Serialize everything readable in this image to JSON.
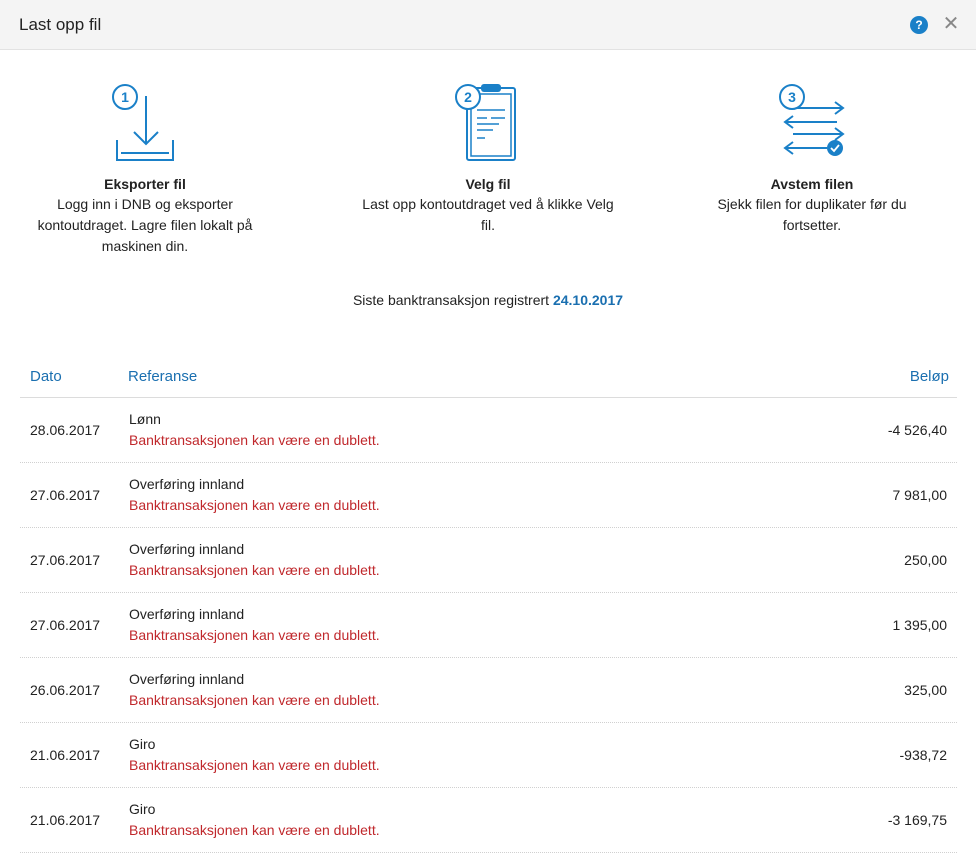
{
  "dialog": {
    "title": "Last opp fil",
    "help_icon": "question-circle-icon",
    "help_label": "?",
    "close_icon": "close-icon",
    "close_label": "✕",
    "accent_color": "#1a80c8"
  },
  "steps": [
    {
      "number": "1",
      "icon": "download-icon",
      "title": "Eksporter fil",
      "desc_lines": [
        "Logg inn i DNB og eksporter",
        "kontoutdraget. Lagre filen lokalt på",
        "maskinen din."
      ]
    },
    {
      "number": "2",
      "icon": "clipboard-icon",
      "title": "Velg fil",
      "desc_lines": [
        "Last opp kontoutdraget ved å klikke Velg",
        "fil."
      ]
    },
    {
      "number": "3",
      "icon": "transfer-arrows-icon",
      "title": "Avstem filen",
      "desc_lines": [
        "Sjekk filen for duplikater før du",
        "fortsetter."
      ]
    }
  ],
  "last_transaction": {
    "label": "Siste banktransaksjon registrert",
    "date": "24.10.2017"
  },
  "table": {
    "headers": {
      "date": "Dato",
      "reference": "Referanse",
      "amount": "Beløp"
    },
    "rows": [
      {
        "date": "28.06.2017",
        "reference": "Lønn",
        "warning": "Banktransaksjonen kan være en dublett.",
        "amount": "-4 526,40"
      },
      {
        "date": "27.06.2017",
        "reference": "Overføring innland",
        "warning": "Banktransaksjonen kan være en dublett.",
        "amount": "7 981,00"
      },
      {
        "date": "27.06.2017",
        "reference": "Overføring innland",
        "warning": "Banktransaksjonen kan være en dublett.",
        "amount": "250,00"
      },
      {
        "date": "27.06.2017",
        "reference": "Overføring innland",
        "warning": "Banktransaksjonen kan være en dublett.",
        "amount": "1 395,00"
      },
      {
        "date": "26.06.2017",
        "reference": "Overføring innland",
        "warning": "Banktransaksjonen kan være en dublett.",
        "amount": "325,00"
      },
      {
        "date": "21.06.2017",
        "reference": "Giro",
        "warning": "Banktransaksjonen kan være en dublett.",
        "amount": "-938,72"
      },
      {
        "date": "21.06.2017",
        "reference": "Giro",
        "warning": "Banktransaksjonen kan være en dublett.",
        "amount": "-3 169,75"
      }
    ]
  }
}
